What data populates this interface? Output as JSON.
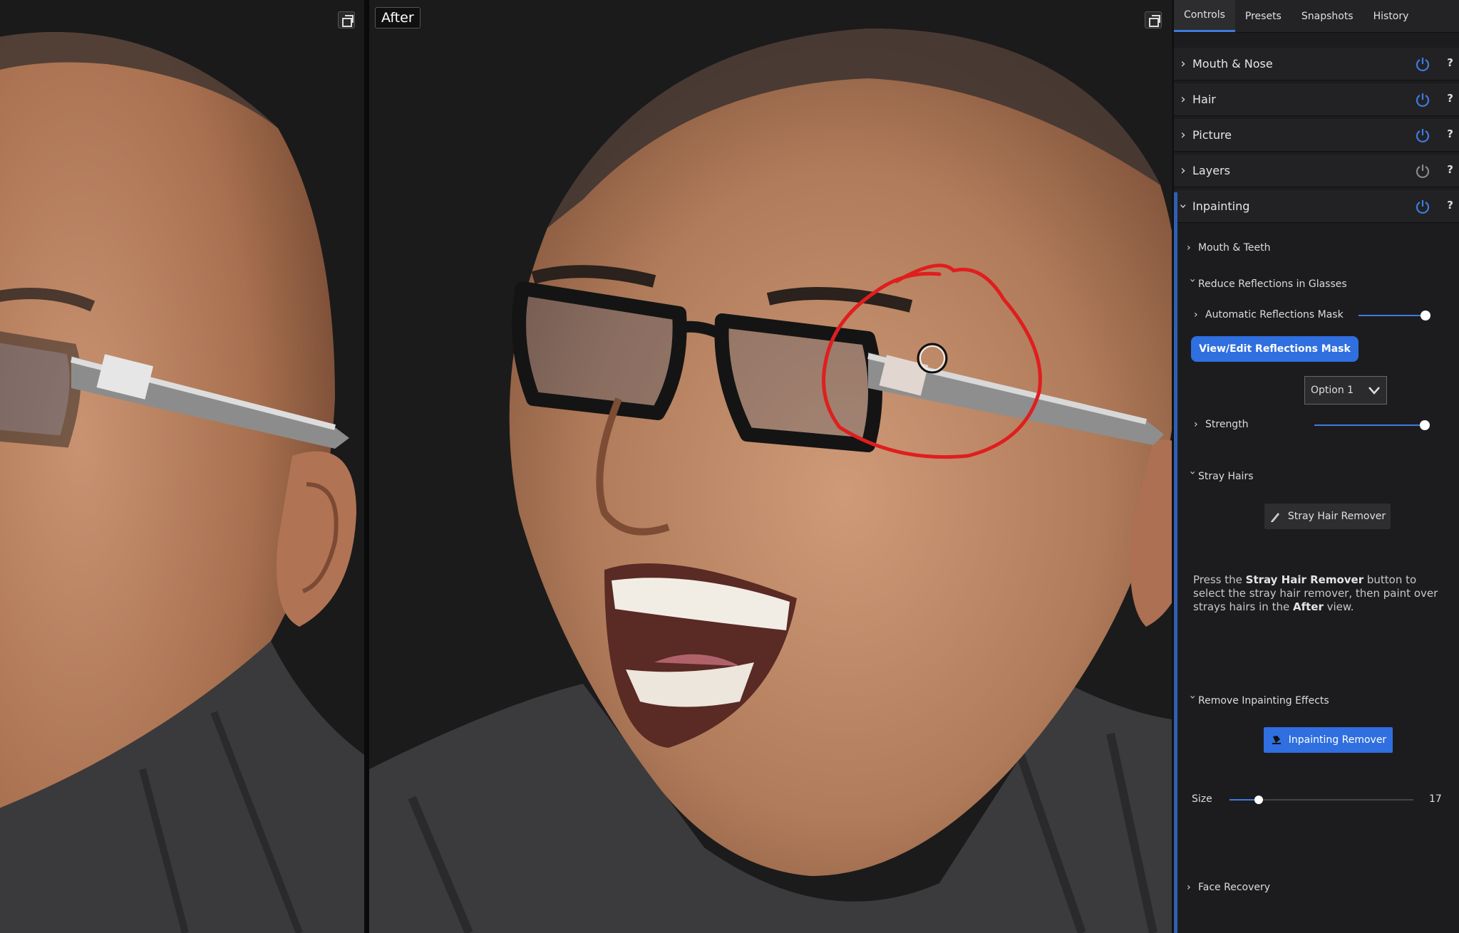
{
  "view": {
    "after_label": "After"
  },
  "panel": {
    "tabs": [
      "Controls",
      "Presets",
      "Snapshots",
      "History"
    ],
    "active_tab": "Controls",
    "sections": [
      {
        "label": "Mouth & Nose",
        "enabled": true
      },
      {
        "label": "Hair",
        "enabled": true
      },
      {
        "label": "Picture",
        "enabled": true
      },
      {
        "label": "Layers",
        "enabled": false
      },
      {
        "label": "Inpainting",
        "enabled": true,
        "expanded": true
      }
    ],
    "inpainting": {
      "mouth_teeth": "Mouth & Teeth",
      "reduce_reflections": "Reduce Reflections in Glasses",
      "auto_mask_label": "Automatic Reflections Mask",
      "auto_mask_value": 0.98,
      "view_edit_button": "View/Edit Reflections Mask",
      "option_select": "Option 1",
      "strength_label": "Strength",
      "strength_value": 0.98,
      "stray_hairs": "Stray Hairs",
      "stray_hair_button": "Stray Hair Remover",
      "help_prefix": "Press the ",
      "help_bold1": "Stray Hair Remover",
      "help_mid": " button to select the stray hair remover, then paint over strays hairs in the ",
      "help_bold2": "After",
      "help_suffix": " view.",
      "remove_effects": "Remove Inpainting Effects",
      "inpainting_remover_button": "Inpainting Remover",
      "size_label": "Size",
      "size_value": "17",
      "size_fraction": 0.16,
      "face_recovery": "Face Recovery"
    }
  },
  "colors": {
    "accent": "#3d7be0",
    "annotation": "#e01e1e"
  }
}
